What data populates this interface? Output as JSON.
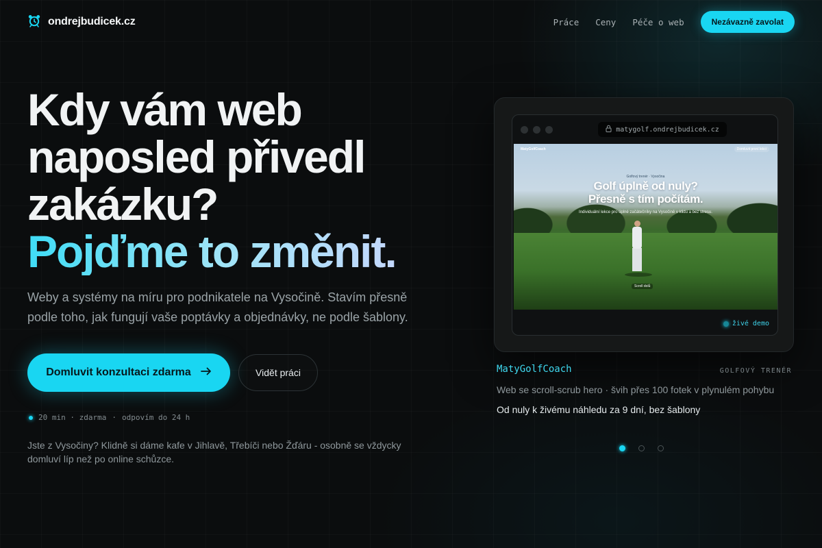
{
  "header": {
    "logo_icon": "alarm-clock-icon",
    "site_name": "ondrejbudicek",
    "site_tld": ".cz",
    "nav": [
      {
        "label": "Práce"
      },
      {
        "label": "Ceny"
      },
      {
        "label": "Péče o web"
      }
    ],
    "cta_label": "Nezávazně zavolat"
  },
  "hero": {
    "title_lines": [
      "Kdy vám web",
      "naposled přivedl",
      "zakázku?"
    ],
    "title_accent": "Pojďme to změnit.",
    "subtitle": "Weby a systémy na míru pro podnikatele na Vysočině. Stavím přesně podle toho, jak fungují vaše poptávky a objednávky, ne podle šablony.",
    "primary_button": "Domluvit konzultaci zdarma",
    "primary_button_icon": "arrow-right-icon",
    "secondary_button": "Vidět práci",
    "meta_left": "20 min · zdarma",
    "meta_sep": "·",
    "meta_right": "odpovím do 24 h",
    "local_note": "Jste z Vysočiny? Klidně si dáme kafe v Jihlavě, Třebíči nebo Žďáru - osobně se vždycky domluví líp než po online schůzce."
  },
  "showcase": {
    "url": "matygolf.ondrejbudicek.cz",
    "url_icon": "lock-icon",
    "preview": {
      "nav_brand": "MatyGolfCoach",
      "nav_button": "Domluvit první lekci",
      "kicker": "Golfový trenér · Vysočina",
      "title_line1": "Golf úplně od nuly?",
      "title_line2": "Přesně s tím počítám.",
      "desc": "Individuální lekce pro úplné začátečníky na Vysočině v klidu a bez stresu.",
      "scroll_label": "Scroll dolů"
    },
    "live_label": "živé demo",
    "project_name": "MatyGolfCoach",
    "project_tag": "GOLFOVÝ TRENÉR",
    "project_desc": "Web se scroll-scrub hero · švih přes 100 fotek v plynulém pohybu",
    "project_result": "Od nuly k živému náhledu za 9 dní, bez šablony",
    "carousel": {
      "count": 3,
      "active": 1
    }
  },
  "colors": {
    "background": "#0b0d0e",
    "accent": "#19d6f2",
    "text": "#f1f3f4",
    "muted": "#9aa3a7"
  }
}
